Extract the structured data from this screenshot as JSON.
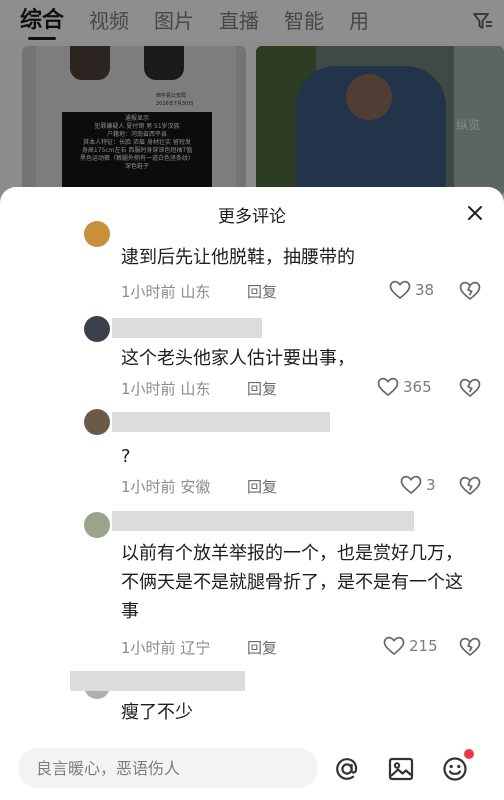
{
  "tabs": [
    "综合",
    "视频",
    "图片",
    "直播",
    "智能",
    "用"
  ],
  "background": {
    "notice_title": "通报显示",
    "notice_lines": [
      "犯罪嫌疑人 夏付钢 男 51岁汉族",
      "户籍地：河南省西平县",
      "其本人特征：长脸 浓眉 身材壮实 留短发",
      "身高175cm左右 西服时身穿深色短袖T恤",
      "黑色运动裤（裤腿外侧有一道白色竖条纹）",
      "深色鞋子"
    ],
    "poster_meta": [
      "西平县公安局",
      "2026年7月30日"
    ],
    "watermark": "纵览"
  },
  "sheet": {
    "title": "更多评论"
  },
  "comments": [
    {
      "text": "逮到后先让他脱鞋，抽腰带的",
      "time": "1小时前",
      "location": "山东",
      "reply": "回复",
      "likes": "38"
    },
    {
      "text": "这个老头他家人估计要出事，",
      "time": "1小时前",
      "location": "山东",
      "reply": "回复",
      "likes": "365"
    },
    {
      "text": "?",
      "time": "1小时前",
      "location": "安徽",
      "reply": "回复",
      "likes": "3"
    },
    {
      "text": "以前有个放羊举报的一个，也是赏好几万，不俩天是不是就腿骨折了，是不是有一个这事",
      "time": "1小时前",
      "location": "辽宁",
      "reply": "回复",
      "likes": "215"
    },
    {
      "text": "瘦了不少"
    }
  ],
  "input": {
    "placeholder": "良言暖心，恶语伤人"
  },
  "colors": {
    "badge": "#f0374a",
    "overlay": "rgba(0,0,0,0.42)"
  }
}
